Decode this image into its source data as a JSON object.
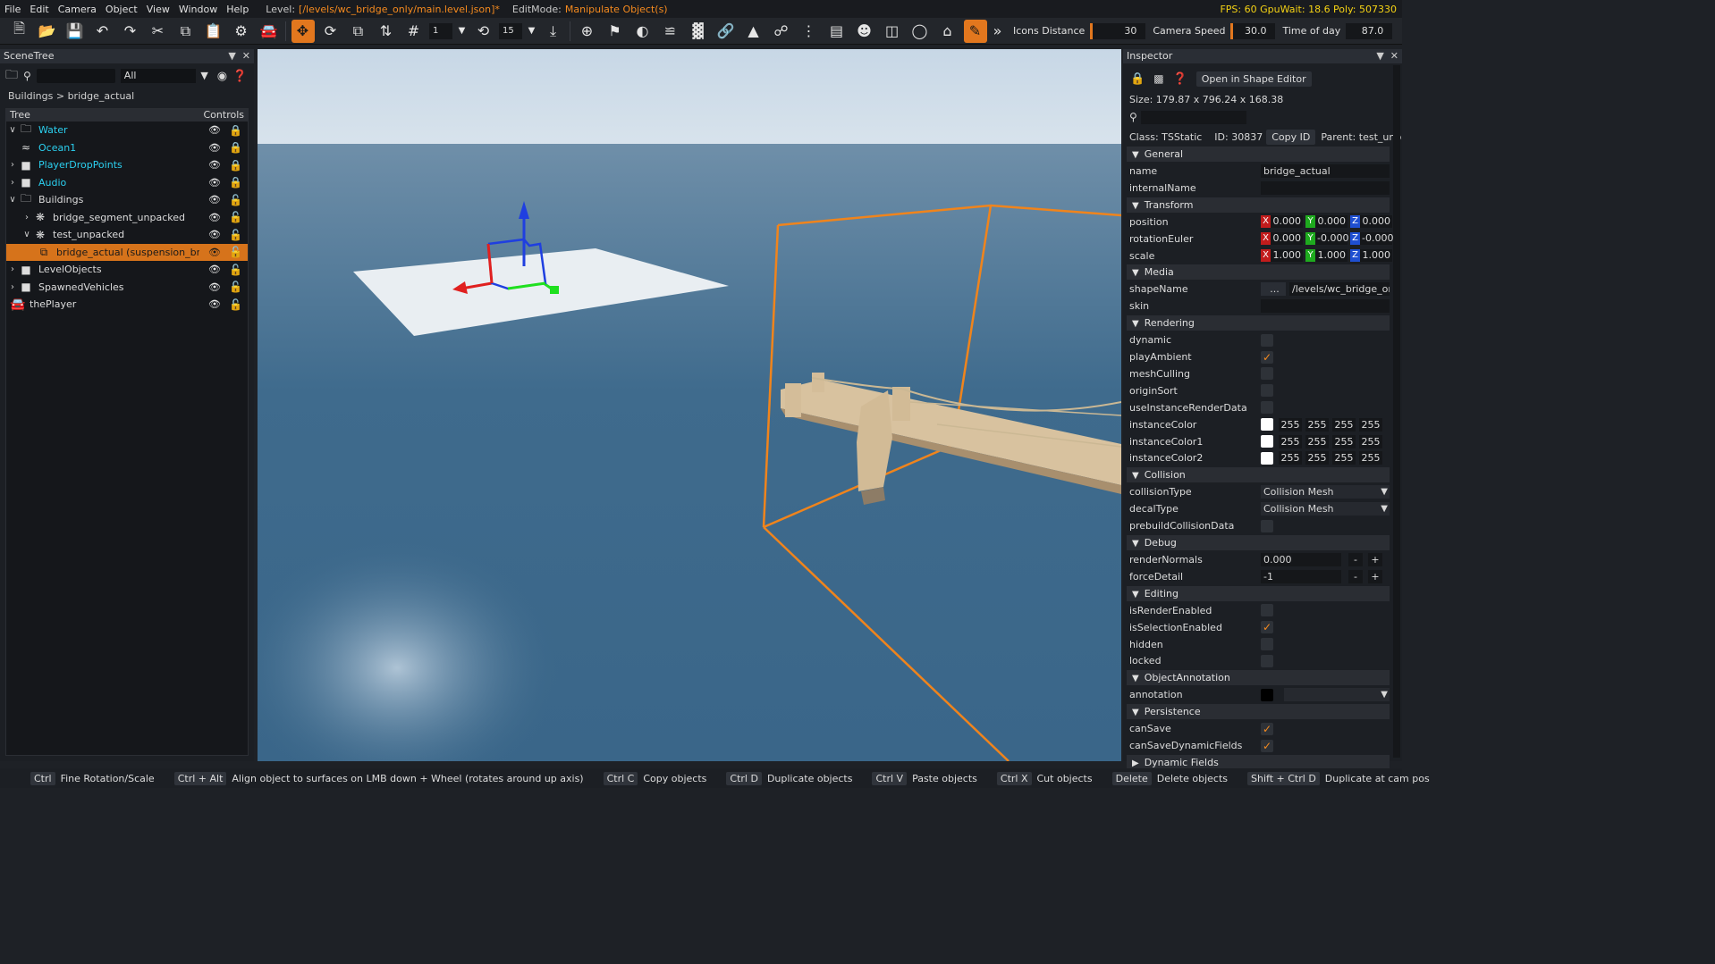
{
  "menu": {
    "items": [
      "File",
      "Edit",
      "Camera",
      "Object",
      "View",
      "Window",
      "Help"
    ],
    "level_label": "Level:",
    "level_value": "[/levels/wc_bridge_only/main.level.json]*",
    "editmode_label": "EditMode:",
    "editmode_value": "Manipulate Object(s)",
    "stats": "FPS: 60  GpuWait: 18.6  Poly: 507330"
  },
  "toolbar": {
    "snap_value": "1",
    "rot_snap_value": "15",
    "icons_distance_label": "Icons Distance",
    "icons_distance_value": "30",
    "camera_speed_label": "Camera Speed",
    "camera_speed_value": "30.0",
    "time_of_day_label": "Time of day",
    "time_of_day_value": "87.0"
  },
  "scenetree": {
    "title": "SceneTree",
    "filter": "All",
    "breadcrumb": "Buildings  >  bridge_actual (suspension_bridge.dae)",
    "col_tree": "Tree",
    "col_controls": "Controls",
    "rows": [
      {
        "name": "Water"
      },
      {
        "name": "Ocean1"
      },
      {
        "name": "PlayerDropPoints"
      },
      {
        "name": "Audio"
      },
      {
        "name": "Buildings"
      },
      {
        "name": "bridge_segment_unpacked"
      },
      {
        "name": "test_unpacked"
      },
      {
        "name": "bridge_actual (suspension_bridge.dae)"
      },
      {
        "name": "LevelObjects"
      },
      {
        "name": "SpawnedVehicles"
      },
      {
        "name": "thePlayer"
      }
    ]
  },
  "inspector": {
    "title": "Inspector",
    "open_shape_editor": "Open in Shape Editor",
    "size": "Size: 179.87 x 796.24 x 168.38",
    "class": "Class: TSStatic",
    "id": "ID: 30837",
    "copy_id": "Copy ID",
    "parent": "Parent: test_unpacked",
    "sections": {
      "general": "General",
      "transform": "Transform",
      "media": "Media",
      "rendering": "Rendering",
      "collision": "Collision",
      "debug": "Debug",
      "editing": "Editing",
      "annotation": "ObjectAnnotation",
      "persistence": "Persistence",
      "dynamic": "Dynamic Fields"
    },
    "fields": {
      "name_label": "name",
      "name_value": "bridge_actual",
      "internalName_label": "internalName",
      "position_label": "position",
      "position": [
        "0.000",
        "0.000",
        "0.000"
      ],
      "rotation_label": "rotationEuler",
      "rotation": [
        "0.000",
        "-0.000",
        "-0.000"
      ],
      "scale_label": "scale",
      "scale": [
        "1.000",
        "1.000",
        "1.000"
      ],
      "shapeName_label": "shapeName",
      "shapeName_btn": "...",
      "shapeName_value": "/levels/wc_bridge_only/",
      "skin_label": "skin",
      "dynamic_label": "dynamic",
      "playAmbient_label": "playAmbient",
      "meshCulling_label": "meshCulling",
      "originSort_label": "originSort",
      "useInstanceRenderData_label": "useInstanceRenderData",
      "instanceColor_label": "instanceColor",
      "instanceColor1_label": "instanceColor1",
      "instanceColor2_label": "instanceColor2",
      "color_values": [
        "255",
        "255",
        "255",
        "255"
      ],
      "collisionType_label": "collisionType",
      "collisionType_value": "Collision Mesh",
      "decalType_label": "decalType",
      "decalType_value": "Collision Mesh",
      "prebuild_label": "prebuildCollisionData",
      "renderNormals_label": "renderNormals",
      "renderNormals_value": "0.000",
      "forceDetail_label": "forceDetail",
      "forceDetail_value": "-1",
      "isRenderEnabled_label": "isRenderEnabled",
      "isSelectionEnabled_label": "isSelectionEnabled",
      "hidden_label": "hidden",
      "locked_label": "locked",
      "annotation_label": "annotation",
      "canSave_label": "canSave",
      "canSaveDynamic_label": "canSaveDynamicFields",
      "minus": "-",
      "plus": "+"
    }
  },
  "statusbar": [
    {
      "key": "Ctrl",
      "desc": "Fine Rotation/Scale"
    },
    {
      "key": "Ctrl + Alt",
      "desc": "Align object to surfaces on LMB down + Wheel (rotates around up axis)"
    },
    {
      "key": "Ctrl C",
      "desc": "Copy objects"
    },
    {
      "key": "Ctrl D",
      "desc": "Duplicate objects"
    },
    {
      "key": "Ctrl V",
      "desc": "Paste objects"
    },
    {
      "key": "Ctrl X",
      "desc": "Cut objects"
    },
    {
      "key": "Delete",
      "desc": "Delete objects"
    },
    {
      "key": "Shift + Ctrl D",
      "desc": "Duplicate at cam pos"
    }
  ],
  "colors": {
    "accent": "#e2771e",
    "cyan": "#2bd0f0",
    "selection": "#d6731b"
  }
}
